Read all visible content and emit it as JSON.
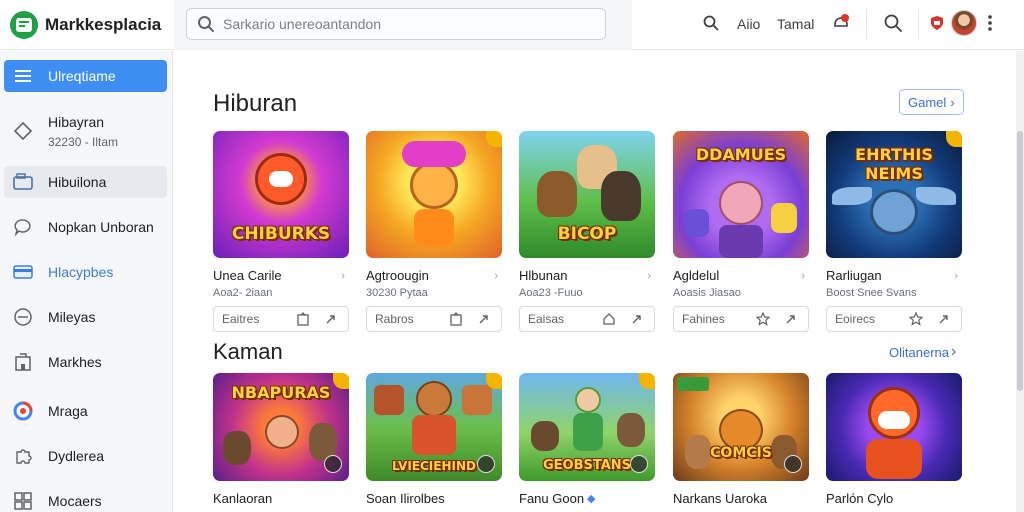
{
  "header": {
    "app_title": "Markkesplacia",
    "search_placeholder": "Sarkario unereoantandon",
    "links": [
      "Aiio",
      "Tamal"
    ]
  },
  "sidebar": {
    "items": [
      {
        "label": "Ulreqtiame",
        "icon": "menu-icon",
        "state": "active"
      },
      {
        "label": "Hibayran",
        "sub": "32230 - Iltam",
        "icon": "shapes-icon"
      },
      {
        "label": "Hibuilona",
        "icon": "wallet-icon",
        "state": "hover"
      },
      {
        "label": "Nopkan Unboran",
        "icon": "chat-bubble-icon"
      },
      {
        "label": "Hlacypbes",
        "icon": "card-icon",
        "state": "blue"
      },
      {
        "label": "Mileyas",
        "icon": "circle-minus-icon"
      },
      {
        "label": "Markhes",
        "icon": "building-icon"
      },
      {
        "label": "Mraga",
        "icon": "colorful-circle-icon"
      },
      {
        "label": "Dydlerea",
        "icon": "puzzle-icon"
      },
      {
        "label": "Mocaers",
        "icon": "grid-icon"
      }
    ]
  },
  "sections": [
    {
      "title": "Hiburan",
      "action": "Gamel",
      "cards": [
        {
          "title": "Unea Carile",
          "sub": "Aoa2- 2iaan",
          "art": "CHIBURKS",
          "action": "Eaitres"
        },
        {
          "title": "Agtroougin",
          "sub": "30230 Pytaa",
          "art": "",
          "action": "Rabros"
        },
        {
          "title": "Hlbunan",
          "sub": "Aoa23 -Fuuo",
          "art": "BICOP",
          "action": "Eaisas"
        },
        {
          "title": "Agldelul",
          "sub": "Aoasis Jiasao",
          "art": "DDAMUES",
          "action": "Fahines"
        },
        {
          "title": "Rarliugan",
          "sub": "Boost Snee Svans",
          "art": "EHRTHIS NEIMS",
          "action": "Eoirecs"
        }
      ]
    },
    {
      "title": "Kaman",
      "action": "Olitanerna",
      "cards": [
        {
          "title": "Kanlaoran",
          "art": "NBAPURAS"
        },
        {
          "title": "Soan Ilirolbes",
          "art": "LVIECIEHIND"
        },
        {
          "title": "Fanu Goon",
          "art": "GEOBSTANS"
        },
        {
          "title": "Narkans Uaroka",
          "art": "COMCIS"
        },
        {
          "title": "Parlón Cylo",
          "art": ""
        }
      ]
    }
  ]
}
